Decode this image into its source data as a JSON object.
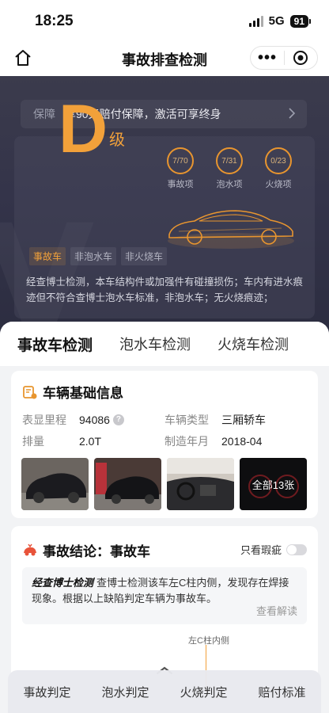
{
  "status": {
    "time": "18:25",
    "network": "5G",
    "battery": "91"
  },
  "nav": {
    "title": "事故排查检测"
  },
  "hero": {
    "warranty_label": "保障",
    "warranty_text": "享90天赔付保障，激活可享终身",
    "grade": "D",
    "grade_suffix": "级",
    "rings": [
      {
        "value": "7/70",
        "label": "事故项"
      },
      {
        "value": "7/31",
        "label": "泡水项"
      },
      {
        "value": "0/23",
        "label": "火烧项"
      }
    ],
    "tags": [
      "事故车",
      "非泡水车",
      "非火烧车"
    ],
    "description": "经查博士检测，本车结构件或加强件有碰撞损伤；车内有进水痕迹但不符合查博士泡水车标准，非泡水车；无火烧痕迹；"
  },
  "tabs": [
    "事故车检测",
    "泡水车检测",
    "火烧车检测"
  ],
  "basic_info": {
    "title": "车辆基础信息",
    "rows": [
      [
        {
          "k": "表显里程",
          "v": "94086"
        },
        {
          "k": "车辆类型",
          "v": "三厢轿车"
        }
      ],
      [
        {
          "k": "排量",
          "v": "2.0T"
        },
        {
          "k": "制造年月",
          "v": "2018-04"
        }
      ]
    ],
    "all_photos": "全部13张"
  },
  "result": {
    "title": "事故结论：事故车",
    "flaw_toggle": "只看瑕疵",
    "expert_brand": "经查博士检测",
    "expert_text": "查博士检测该车左C柱内侧，发现存在焊接现象。根据以上缺陷判定车辆为事故车。",
    "view_detail": "查看解读",
    "diagram_label": "左C柱内侧"
  },
  "bottom_bar": [
    "事故判定",
    "泡水判定",
    "火烧判定",
    "赔付标准"
  ],
  "colors": {
    "accent": "#f2a13a",
    "hero_bg": "#34344a"
  }
}
